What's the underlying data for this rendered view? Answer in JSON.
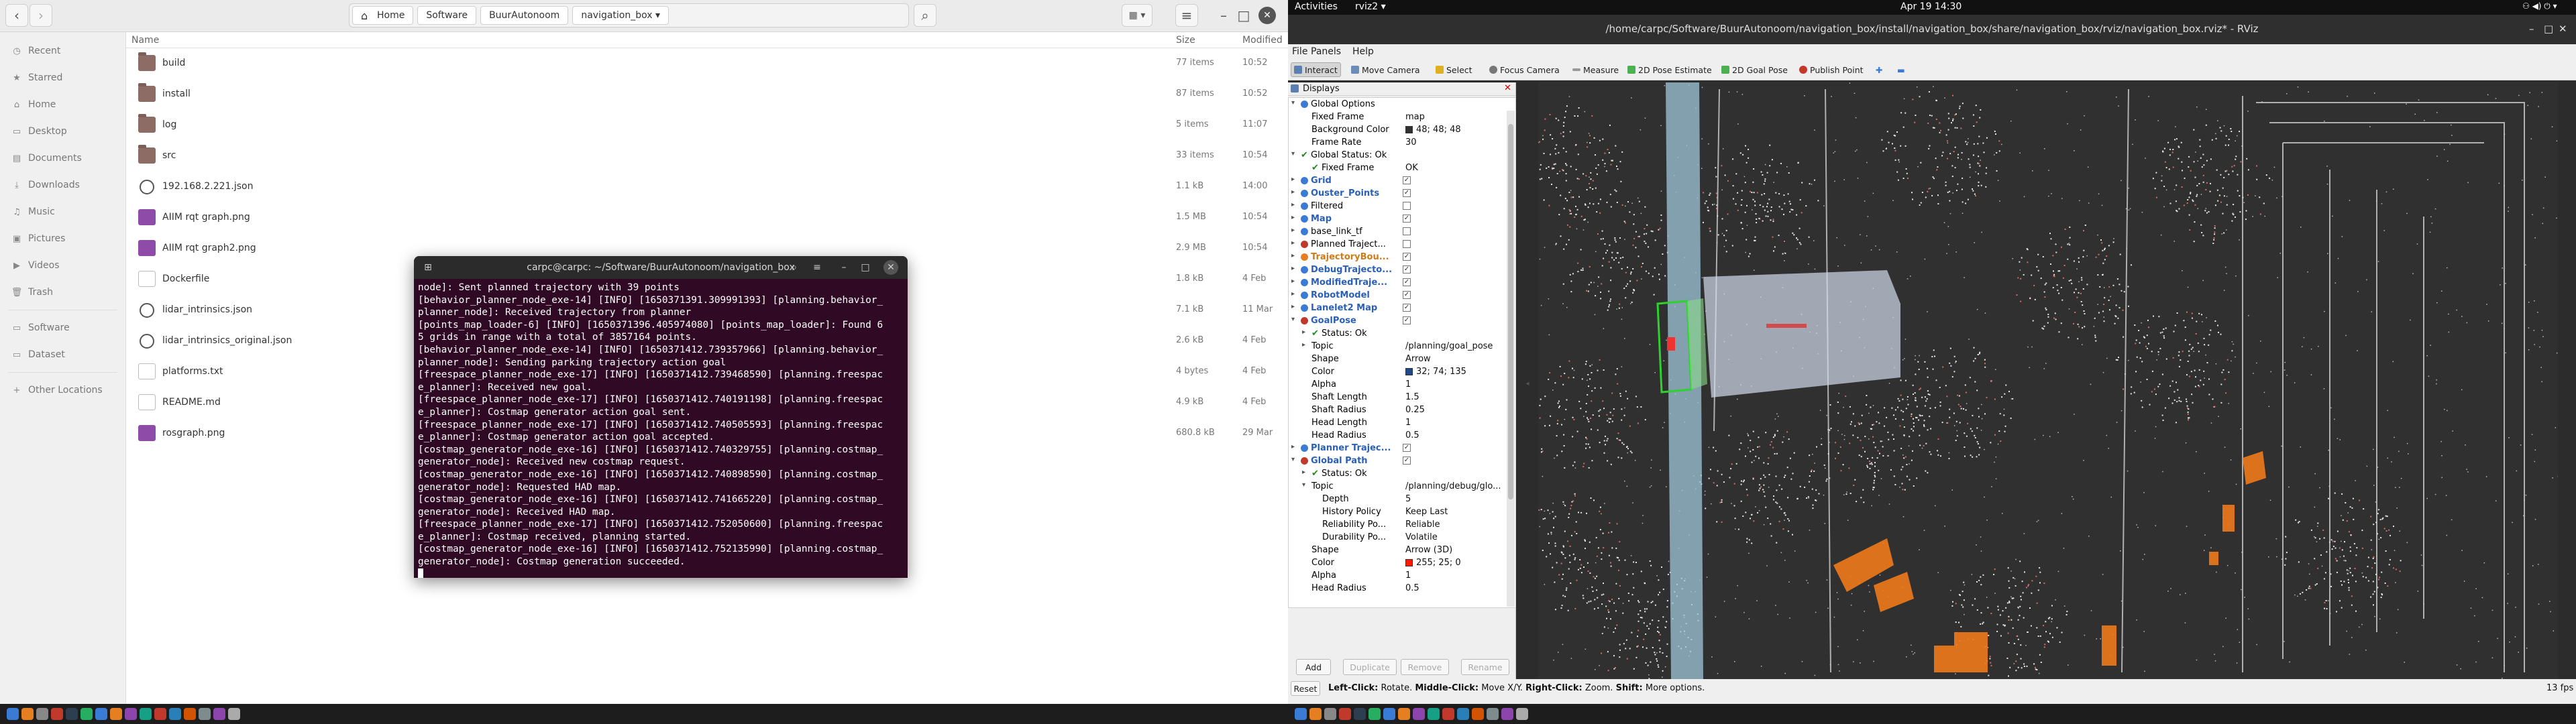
{
  "file_manager": {
    "breadcrumbs": [
      "Home",
      "Software",
      "BuurAutonoom",
      "navigation_box"
    ],
    "columns": {
      "name": "Name",
      "size": "Size",
      "modified": "Modified"
    },
    "sidebar": [
      {
        "label": "Recent",
        "icon": "clock-icon"
      },
      {
        "label": "Starred",
        "icon": "star-icon"
      },
      {
        "label": "Home",
        "icon": "home-icon"
      },
      {
        "label": "Desktop",
        "icon": "desktop-icon"
      },
      {
        "label": "Documents",
        "icon": "document-icon"
      },
      {
        "label": "Downloads",
        "icon": "download-icon"
      },
      {
        "label": "Music",
        "icon": "music-icon"
      },
      {
        "label": "Pictures",
        "icon": "picture-icon"
      },
      {
        "label": "Videos",
        "icon": "video-icon"
      },
      {
        "label": "Trash",
        "icon": "trash-icon"
      },
      {
        "label": "Software",
        "icon": "folder-icon"
      },
      {
        "label": "Dataset",
        "icon": "folder-icon"
      },
      {
        "label": "Other Locations",
        "icon": "plus-icon"
      }
    ],
    "files": [
      {
        "name": "build",
        "size": "77 items",
        "modified": "10:52",
        "type": "folder"
      },
      {
        "name": "install",
        "size": "87 items",
        "modified": "10:52",
        "type": "folder"
      },
      {
        "name": "log",
        "size": "5 items",
        "modified": "11:07",
        "type": "folder"
      },
      {
        "name": "src",
        "size": "33 items",
        "modified": "10:54",
        "type": "folder"
      },
      {
        "name": "192.168.2.221.json",
        "size": "1.1 kB",
        "modified": "14:00",
        "type": "json"
      },
      {
        "name": "AIIM rqt graph.png",
        "size": "1.5 MB",
        "modified": "10:54",
        "type": "img"
      },
      {
        "name": "AIIM rqt graph2.png",
        "size": "2.9 MB",
        "modified": "10:54",
        "type": "img"
      },
      {
        "name": "Dockerfile",
        "size": "1.8 kB",
        "modified": "4 Feb",
        "type": "txt"
      },
      {
        "name": "lidar_intrinsics.json",
        "size": "7.1 kB",
        "modified": "11 Mar",
        "type": "json"
      },
      {
        "name": "lidar_intrinsics_original.json",
        "size": "2.6 kB",
        "modified": "4 Feb",
        "type": "json"
      },
      {
        "name": "platforms.txt",
        "size": "4 bytes",
        "modified": "4 Feb",
        "type": "txt"
      },
      {
        "name": "README.md",
        "size": "4.9 kB",
        "modified": "4 Feb",
        "type": "txt"
      },
      {
        "name": "rosgraph.png",
        "size": "680.8 kB",
        "modified": "29 Mar",
        "type": "img"
      }
    ]
  },
  "terminal": {
    "title": "carpc@carpc: ~/Software/BuurAutonoom/navigation_box",
    "lines": [
      "node]: Sent planned trajectory with 39 points",
      "[behavior_planner_node_exe-14] [INFO] [1650371391.309991393] [planning.behavior_",
      "planner_node]: Received trajectory from planner",
      "[points_map_loader-6] [INFO] [1650371396.405974080] [points_map_loader]: Found 6",
      "5 grids in range with a total of 3857164 points.",
      "[behavior_planner_node_exe-14] [INFO] [1650371412.739357966] [planning.behavior_",
      "planner_node]: Sending parking trajectory action goal",
      "[freespace_planner_node_exe-17] [INFO] [1650371412.739468590] [planning.freespac",
      "e_planner]: Received new goal.",
      "[freespace_planner_node_exe-17] [INFO] [1650371412.740191198] [planning.freespac",
      "e_planner]: Costmap generator action goal sent.",
      "[freespace_planner_node_exe-17] [INFO] [1650371412.740505593] [planning.freespac",
      "e_planner]: Costmap generator action goal accepted.",
      "[costmap_generator_node_exe-16] [INFO] [1650371412.740329755] [planning.costmap_",
      "generator_node]: Received new costmap request.",
      "[costmap_generator_node_exe-16] [INFO] [1650371412.740898590] [planning.costmap_",
      "generator_node]: Requested HAD map.",
      "[costmap_generator_node_exe-16] [INFO] [1650371412.741665220] [planning.costmap_",
      "generator_node]: Received HAD map.",
      "[freespace_planner_node_exe-17] [INFO] [1650371412.752050600] [planning.freespac",
      "e_planner]: Costmap received, planning started.",
      "[costmap_generator_node_exe-16] [INFO] [1650371412.752135990] [planning.costmap_",
      "generator_node]: Costmap generation succeeded."
    ]
  },
  "topbar": {
    "activities": "Activities",
    "app": "rviz2",
    "clock": "Apr 19  14:30"
  },
  "rviz": {
    "title": "/home/carpc/Software/BuurAutonoom/navigation_box/install/navigation_box/share/navigation_box/rviz/navigation_box.rviz* - RViz",
    "menu": [
      "File",
      "Panels",
      "Help"
    ],
    "tools": [
      "Interact",
      "Move Camera",
      "Select",
      "Focus Camera",
      "Measure",
      "2D Pose Estimate",
      "2D Goal Pose",
      "Publish Point"
    ],
    "panel_title": "Displays",
    "tree": [
      {
        "label": "Global Options",
        "indent": 1,
        "arrow": "▾",
        "icon": "#3a7bd5"
      },
      {
        "label": "Fixed Frame",
        "value": "map",
        "indent": 2
      },
      {
        "label": "Background Color",
        "value": "48; 48; 48",
        "indent": 2,
        "swatch": "#303030"
      },
      {
        "label": "Frame Rate",
        "value": "30",
        "indent": 2
      },
      {
        "label": "Global Status: Ok",
        "indent": 1,
        "arrow": "▾",
        "check": true
      },
      {
        "label": "Fixed Frame",
        "value": "OK",
        "indent": 2,
        "check": true
      },
      {
        "label": "Grid",
        "indent": 1,
        "arrow": "▸",
        "cls": "blue",
        "cb": true,
        "icon": "#3a7bd5"
      },
      {
        "label": "Ouster_Points",
        "indent": 1,
        "arrow": "▸",
        "cls": "blue",
        "cb": true,
        "icon": "#3a7bd5"
      },
      {
        "label": "Filtered",
        "indent": 1,
        "arrow": "▸",
        "cb": false,
        "icon": "#3a7bd5"
      },
      {
        "label": "Map",
        "indent": 1,
        "arrow": "▸",
        "cls": "blue",
        "cb": true,
        "icon": "#3a7bd5"
      },
      {
        "label": "base_link_tf",
        "indent": 1,
        "arrow": "▸",
        "cb": false,
        "icon": "#3a7bd5"
      },
      {
        "label": "Planned Traject...",
        "indent": 1,
        "arrow": "▸",
        "cb": false,
        "icon": "#c0392b"
      },
      {
        "label": "TrajectoryBou...",
        "indent": 1,
        "arrow": "▸",
        "cls": "orange",
        "cb": true,
        "icon": "#e67e22"
      },
      {
        "label": "DebugTrajecto...",
        "indent": 1,
        "arrow": "▸",
        "cls": "blue",
        "cb": true,
        "icon": "#3a7bd5"
      },
      {
        "label": "ModifiedTraje...",
        "indent": 1,
        "arrow": "▸",
        "cls": "blue",
        "cb": true,
        "icon": "#3a7bd5"
      },
      {
        "label": "RobotModel",
        "indent": 1,
        "arrow": "▸",
        "cls": "blue",
        "cb": true,
        "icon": "#3a7bd5"
      },
      {
        "label": "Lanelet2 Map",
        "indent": 1,
        "arrow": "▸",
        "cls": "blue",
        "cb": true,
        "icon": "#3a7bd5"
      },
      {
        "label": "GoalPose",
        "indent": 1,
        "arrow": "▾",
        "cls": "blue",
        "cb": true,
        "icon": "#c0392b"
      },
      {
        "label": "Status: Ok",
        "indent": 2,
        "arrow": "▸",
        "check": true
      },
      {
        "label": "Topic",
        "value": "/planning/goal_pose",
        "indent": 2,
        "arrow": "▸"
      },
      {
        "label": "Shape",
        "value": "Arrow",
        "indent": 2
      },
      {
        "label": "Color",
        "value": "32; 74; 135",
        "indent": 2,
        "swatch": "#204a87"
      },
      {
        "label": "Alpha",
        "value": "1",
        "indent": 2
      },
      {
        "label": "Shaft Length",
        "value": "1.5",
        "indent": 2
      },
      {
        "label": "Shaft Radius",
        "value": "0.25",
        "indent": 2
      },
      {
        "label": "Head Length",
        "value": "1",
        "indent": 2
      },
      {
        "label": "Head Radius",
        "value": "0.5",
        "indent": 2
      },
      {
        "label": "Planner Trajec...",
        "indent": 1,
        "arrow": "▸",
        "cls": "blue",
        "cb": true,
        "icon": "#3a7bd5"
      },
      {
        "label": "Global Path",
        "indent": 1,
        "arrow": "▾",
        "cls": "blue",
        "cb": true,
        "icon": "#c0392b"
      },
      {
        "label": "Status: Ok",
        "indent": 2,
        "arrow": "▸",
        "check": true
      },
      {
        "label": "Topic",
        "value": "/planning/debug/glo...",
        "indent": 2,
        "arrow": "▾"
      },
      {
        "label": "Depth",
        "value": "5",
        "indent": 3
      },
      {
        "label": "History Policy",
        "value": "Keep Last",
        "indent": 3
      },
      {
        "label": "Reliability Po...",
        "value": "Reliable",
        "indent": 3
      },
      {
        "label": "Durability Po...",
        "value": "Volatile",
        "indent": 3
      },
      {
        "label": "Shape",
        "value": "Arrow (3D)",
        "indent": 2
      },
      {
        "label": "Color",
        "value": "255; 25; 0",
        "indent": 2,
        "swatch": "#ff1900"
      },
      {
        "label": "Alpha",
        "value": "1",
        "indent": 2
      },
      {
        "label": "Head Radius",
        "value": "0.5",
        "indent": 2
      }
    ],
    "buttons": [
      "Add",
      "Duplicate",
      "Remove",
      "Rename"
    ],
    "status": {
      "reset": "Reset",
      "hint_left": "Left-Click:",
      "hint_left_text": "Rotate.",
      "hint_mid": "Middle-Click:",
      "hint_mid_text": "Move X/Y.",
      "hint_right": "Right-Click:",
      "hint_right_text": "Zoom.",
      "hint_shift": "Shift:",
      "hint_shift_text": "More options.",
      "fps": "13 fps"
    }
  }
}
